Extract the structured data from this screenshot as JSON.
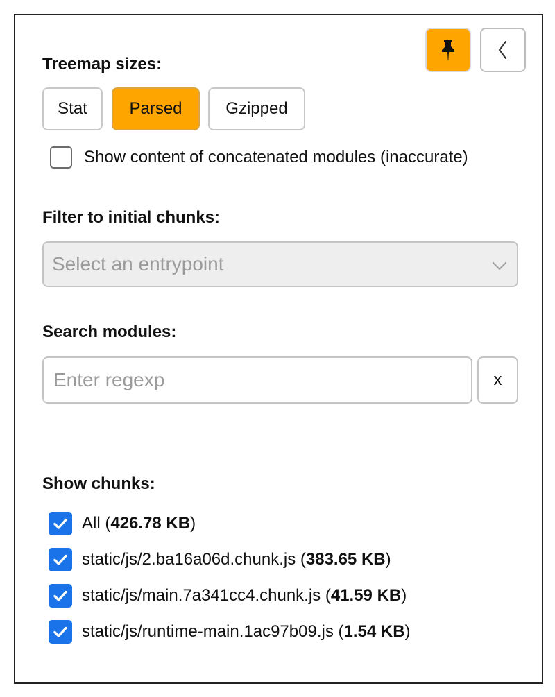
{
  "toolbar": {
    "pin_icon": "pin-icon",
    "collapse_icon": "chevron-left-icon",
    "accent_color": "#ffa500"
  },
  "treemap_sizes": {
    "label": "Treemap sizes:",
    "options": [
      "Stat",
      "Parsed",
      "Gzipped"
    ],
    "selected": "Parsed"
  },
  "concatenated": {
    "label": "Show content of concatenated modules (inaccurate)",
    "checked": false
  },
  "filter": {
    "label": "Filter to initial chunks:",
    "placeholder": "Select an entrypoint"
  },
  "search": {
    "label": "Search modules:",
    "placeholder": "Enter regexp",
    "value": "",
    "clear_label": "x"
  },
  "chunks": {
    "label": "Show chunks:",
    "check_color": "#1a73e8",
    "items": [
      {
        "name": "All",
        "size": "426.78 KB",
        "checked": true
      },
      {
        "name": "static/js/2.ba16a06d.chunk.js",
        "size": "383.65 KB",
        "checked": true
      },
      {
        "name": "static/js/main.7a341cc4.chunk.js",
        "size": "41.59 KB",
        "checked": true
      },
      {
        "name": "static/js/runtime-main.1ac97b09.js",
        "size": "1.54 KB",
        "checked": true
      }
    ]
  }
}
